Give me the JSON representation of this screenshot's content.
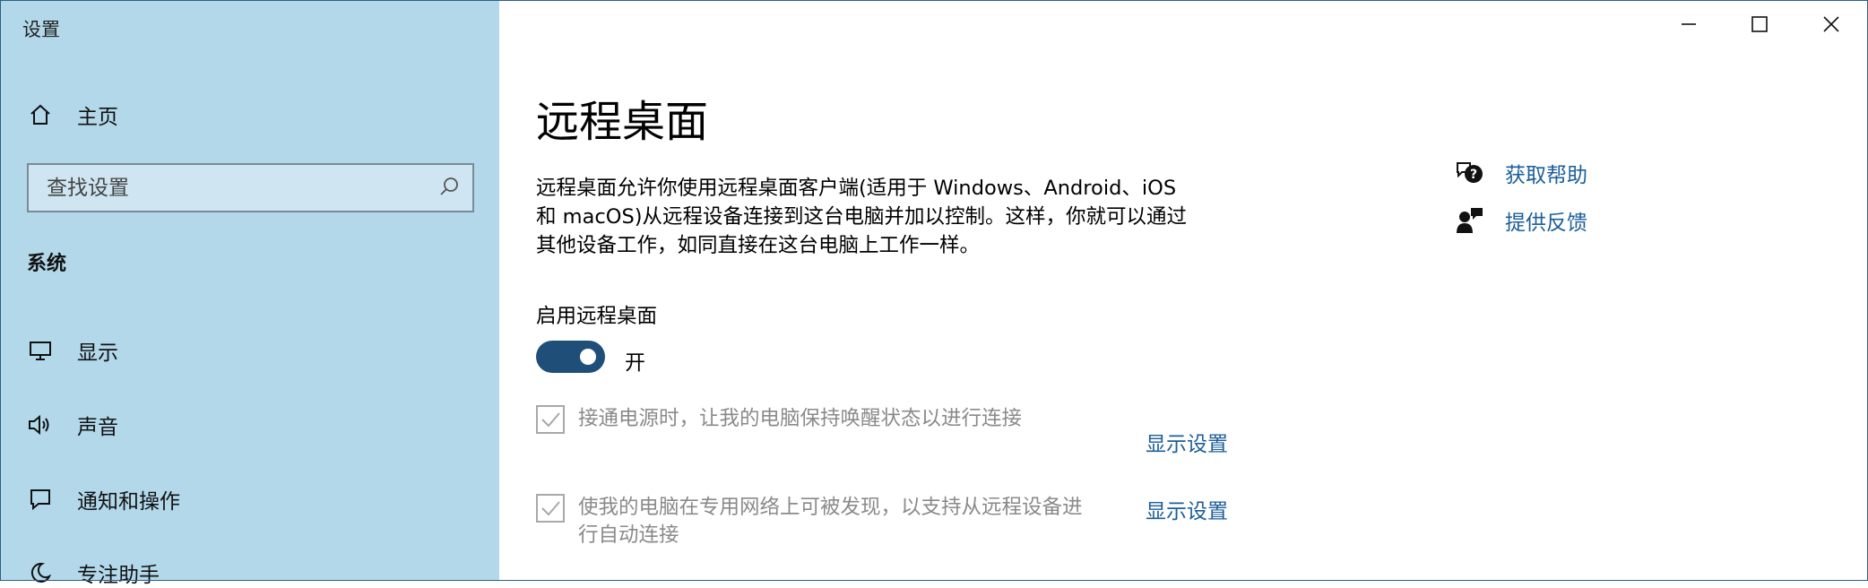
{
  "window": {
    "title": "设置",
    "controls": [
      "minimize-icon",
      "maximize-icon",
      "close-icon"
    ]
  },
  "sidebar": {
    "home_label": "主页",
    "search_placeholder": "查找设置",
    "section_label": "系统",
    "items": [
      {
        "label": "显示",
        "icon": "monitor-icon"
      },
      {
        "label": "声音",
        "icon": "speaker-icon"
      },
      {
        "label": "通知和操作",
        "icon": "notification-icon"
      },
      {
        "label": "专注助手",
        "icon": "moon-icon"
      }
    ]
  },
  "main": {
    "title": "远程桌面",
    "description_lines": [
      "远程桌面允许你使用远程桌面客户端(适用于 Windows、Android、iOS",
      "和 macOS)从远程设备连接到这台电脑并加以控制。这样，你就可以通过",
      "其他设备工作，如同直接在这台电脑上工作一样。"
    ],
    "enable_label": "启用远程桌面",
    "toggle_state": "开",
    "toggle_on": true,
    "options": [
      {
        "lines": [
          "接通电源时，让我的电脑保持唤醒状态以进行连接"
        ],
        "checked": true,
        "link": "显示设置"
      },
      {
        "lines": [
          "使我的电脑在专用网络上可被发现，以支持从远程设备进",
          "行自动连接"
        ],
        "checked": true,
        "link": "显示设置"
      }
    ]
  },
  "related": {
    "help_label": "获取帮助",
    "feedback_label": "提供反馈"
  },
  "colors": {
    "sidebar_bg": "#b2d8ea",
    "accent": "#1f4e79",
    "link": "#1b5e9b"
  }
}
